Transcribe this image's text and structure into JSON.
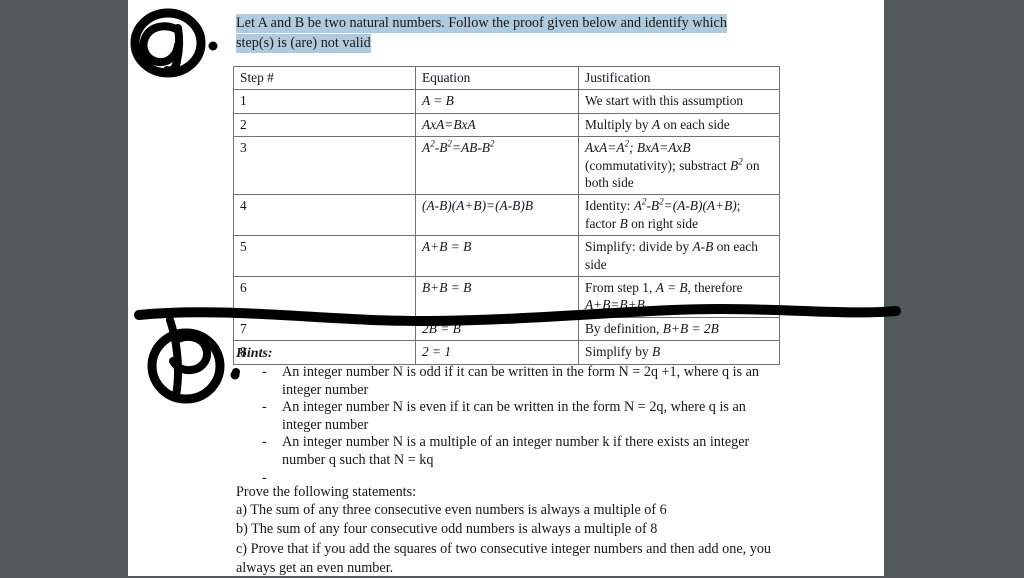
{
  "document": {
    "prompt": {
      "line1": "Let A and B be two natural numbers. Follow the proof given below and identify which",
      "line2": "step(s) is (are) not valid"
    },
    "table": {
      "headers": [
        "Step #",
        "Equation",
        "Justification"
      ],
      "rows": [
        {
          "step": "1",
          "equation": "A = B",
          "justification": "We start with this assumption"
        },
        {
          "step": "2",
          "equation": "AxA=BxA",
          "justification": "Multiply by A on each side"
        },
        {
          "step": "3",
          "equation": "A2-B2=AB-B2",
          "justification": "AxA=A2; BxA=AxB (commutativity); substract B2 on both side"
        },
        {
          "step": "4",
          "equation": "(A-B)(A+B)=(A-B)B",
          "justification": "Identity: A2-B2=(A-B)(A+B); factor B on right side"
        },
        {
          "step": "5",
          "equation": "A+B = B",
          "justification": "Simplify: divide by A-B on each side"
        },
        {
          "step": "6",
          "equation": "B+B = B",
          "justification": "From step 1, A = B, therefore A+B=B+B"
        },
        {
          "step": "7",
          "equation": "2B = B",
          "justification": "By definition, B+B = 2B"
        },
        {
          "step": "8",
          "equation": "2 = 1",
          "justification": "Simplify by B"
        }
      ]
    },
    "hints": {
      "title": "Hints:",
      "dash": "-",
      "items": [
        "An integer number N is odd if it can be written in the form N = 2q +1, where q is an integer number",
        "An integer number N is even if it can be written in the form N = 2q, where q is an integer number",
        "An integer number N is a multiple of an integer number k if there exists an integer number q such that N = kq",
        ""
      ]
    },
    "prove_intro": "Prove the following statements:",
    "statements": [
      "a) The sum of any three consecutive even numbers is always a multiple of 6",
      "b) The sum of any four consecutive odd numbers is always a multiple of 8",
      "c) Prove that if you add the squares of two consecutive integer numbers and then add one, you always get an even number."
    ],
    "annotations": {
      "mark_a": "a)",
      "mark_b": "b)",
      "strikethrough": "horizontal-ink-stroke"
    },
    "colors": {
      "background": "#53585b",
      "page": "#ffffff",
      "highlight": "#afcbdd",
      "ink": "#000000",
      "text": "#17181a"
    }
  }
}
